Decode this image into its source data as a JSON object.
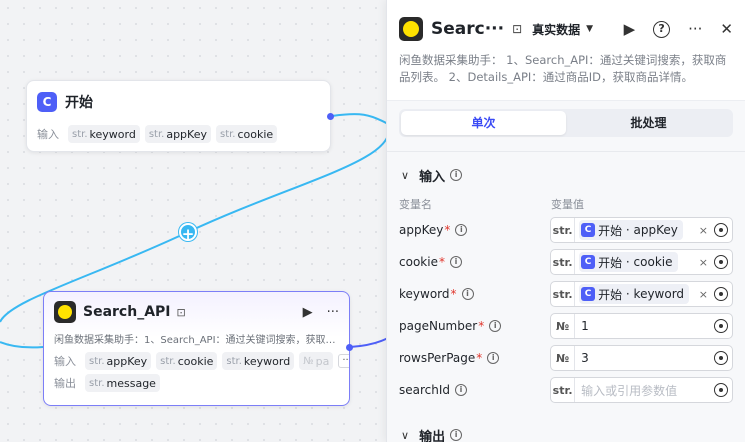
{
  "canvas": {
    "start_node": {
      "title": "开始",
      "icon": "start-icon",
      "inputs_label": "输入",
      "inputs": [
        {
          "type": "str.",
          "name": "keyword"
        },
        {
          "type": "str.",
          "name": "appKey"
        },
        {
          "type": "str.",
          "name": "cookie"
        }
      ]
    },
    "search_node": {
      "title": "Search_API",
      "icon": "plugin-icon",
      "description": "闲鱼数据采集助手：1、Search_API：通过关键词搜索，获取…",
      "inputs_label": "输入",
      "inputs": [
        {
          "type": "str.",
          "name": "appKey",
          "faded": false
        },
        {
          "type": "str.",
          "name": "cookie",
          "faded": false
        },
        {
          "type": "str.",
          "name": "keyword",
          "faded": false
        },
        {
          "type": "№",
          "name": "pa",
          "faded": true
        }
      ],
      "more_label": "···",
      "outputs_label": "输出",
      "outputs": [
        {
          "type": "str.",
          "name": "message"
        }
      ]
    },
    "add_button_label": "+"
  },
  "panel": {
    "title": "Searc···",
    "data_mode": "真实数据",
    "description": "闲鱼数据采集助手： 1、Search_API：通过关键词搜索，获取商品列表。 2、Details_API：通过商品ID，获取商品详情。",
    "tabs": [
      {
        "label": "单次",
        "active": true
      },
      {
        "label": "批处理",
        "active": false
      }
    ],
    "input_section": {
      "title": "输入",
      "col_name": "变量名",
      "col_value": "变量值",
      "params": [
        {
          "name": "appKey",
          "required": true,
          "type": "str.",
          "ref_node": "开始",
          "ref_var": "appKey",
          "value": null,
          "placeholder": null
        },
        {
          "name": "cookie",
          "required": true,
          "type": "str.",
          "ref_node": "开始",
          "ref_var": "cookie",
          "value": null,
          "placeholder": null
        },
        {
          "name": "keyword",
          "required": true,
          "type": "str.",
          "ref_node": "开始",
          "ref_var": "keyword",
          "value": null,
          "placeholder": null
        },
        {
          "name": "pageNumber",
          "required": true,
          "type": "№",
          "ref_node": null,
          "ref_var": null,
          "value": "1",
          "placeholder": null
        },
        {
          "name": "rowsPerPage",
          "required": true,
          "type": "№",
          "ref_node": null,
          "ref_var": null,
          "value": "3",
          "placeholder": null
        },
        {
          "name": "searchId",
          "required": false,
          "type": "str.",
          "ref_node": null,
          "ref_var": null,
          "value": null,
          "placeholder": "输入或引用参数值"
        }
      ]
    },
    "output_section": {
      "title": "输出"
    }
  },
  "colors": {
    "accent": "#3b4bf5",
    "node_icon": "#4e5ff7",
    "edge": "#38b8f2",
    "required": "#e0352b"
  }
}
